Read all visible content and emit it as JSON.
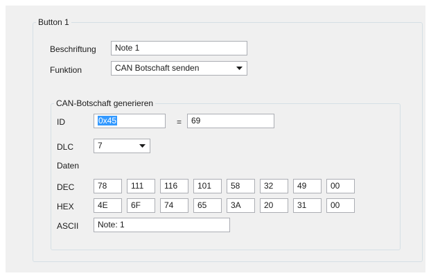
{
  "button_group": {
    "title": "Button 1",
    "caption_label": "Beschriftung",
    "caption_value": "Note 1",
    "function_label": "Funktion",
    "function_value": "CAN Botschaft senden"
  },
  "can_group": {
    "title": "CAN-Botschaft generieren",
    "id_label": "ID",
    "id_hex_value": "0x45",
    "equals": "=",
    "id_dec_value": "69",
    "dlc_label": "DLC",
    "dlc_value": "7",
    "data_label": "Daten",
    "dec_label": "DEC",
    "hex_label": "HEX",
    "ascii_label": "ASCII",
    "dec_values": [
      "78",
      "111",
      "116",
      "101",
      "58",
      "32",
      "49",
      "00"
    ],
    "hex_values": [
      "4E",
      "6F",
      "74",
      "65",
      "3A",
      "20",
      "31",
      "00"
    ],
    "ascii_value": "Note: 1"
  },
  "colors": {
    "panel_bg": "#f0f0f0",
    "selection": "#3399ff",
    "border": "#abadb3"
  },
  "icons": {
    "dropdown": "chevron-down-icon"
  }
}
